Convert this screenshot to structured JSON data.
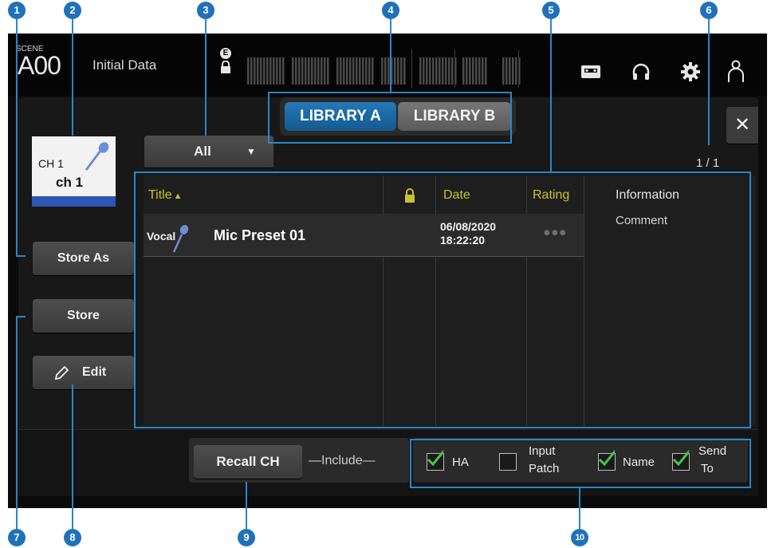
{
  "callouts": [
    "1",
    "2",
    "3",
    "4",
    "5",
    "6",
    "7",
    "8",
    "9",
    "10"
  ],
  "header": {
    "scene_label": "SCENE",
    "scene_number": "A00",
    "scene_name": "Initial Data",
    "icons": [
      "e-indicator-icon",
      "lock-icon",
      "recorder-icon",
      "headphones-icon",
      "settings-gear-icon",
      "user-icon"
    ]
  },
  "library_tabs": [
    "LIBRARY A",
    "LIBRARY B"
  ],
  "channel": {
    "id": "CH 1",
    "name": "ch 1",
    "color": "#2f55b4"
  },
  "filter": {
    "value": "All"
  },
  "page_indicator": "1 / 1",
  "buttons": {
    "store_as": "Store As",
    "store": "Store",
    "edit": "Edit",
    "recall": "Recall CH",
    "close": "✕"
  },
  "list": {
    "columns": {
      "title": "Title",
      "sort_arrow": "▲",
      "date": "Date",
      "rating": "Rating",
      "information": "Information"
    },
    "rows": [
      {
        "category": "Vocal",
        "title": "Mic Preset 01",
        "date": "06/08/2020",
        "time": "18:22:20",
        "rating": "●●●",
        "comment": "Comment"
      }
    ]
  },
  "include": {
    "label": "Include",
    "options": [
      {
        "label": "HA",
        "checked": true
      },
      {
        "label_line1": "Input",
        "label_line2": "Patch",
        "checked": false
      },
      {
        "label": "Name",
        "checked": true
      },
      {
        "label_line1": "Send",
        "label_line2": "To",
        "checked": true
      }
    ]
  },
  "colors": {
    "accent": "#2a86c9",
    "active_tab": "#1b6aa5",
    "title_header": "#c9c231",
    "check": "#4bc24b"
  }
}
